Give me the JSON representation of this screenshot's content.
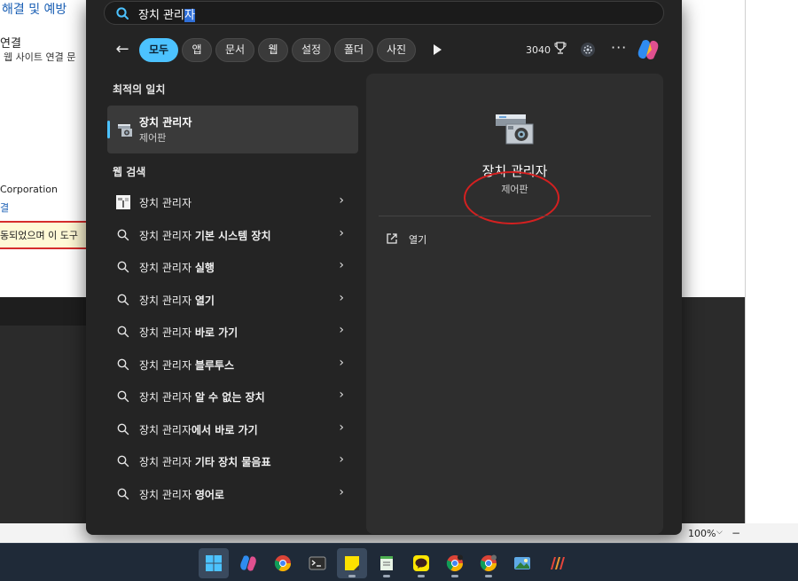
{
  "background_app": {
    "heading": "해결 및 예방",
    "sub1": "연결",
    "sub2": "웹 사이트 연결 문",
    "corp": "Corporation",
    "corp_link": "결",
    "alert": "동되었으며 이 도구",
    "zoom": "100%"
  },
  "search": {
    "query_plain": "장치 관리",
    "query_selected": "자"
  },
  "filters": [
    "모두",
    "앱",
    "문서",
    "웹",
    "설정",
    "폴더",
    "사진"
  ],
  "rewards": {
    "points": "3040"
  },
  "best_match": {
    "section_label": "최적의 일치",
    "title": "장치 관리자",
    "subtitle": "제어판"
  },
  "web_search": {
    "section_label": "웹 검색",
    "results": [
      {
        "base": "장치 관리자",
        "bold": ""
      },
      {
        "base": "장치 관리자 ",
        "bold": "기본 시스템 장치"
      },
      {
        "base": "장치 관리자 ",
        "bold": "실행"
      },
      {
        "base": "장치 관리자 ",
        "bold": "열기"
      },
      {
        "base": "장치 관리자 ",
        "bold": "바로 가기"
      },
      {
        "base": "장치 관리자 ",
        "bold": "블루투스"
      },
      {
        "base": "장치 관리자 ",
        "bold": "알 수 없는 장치"
      },
      {
        "base": "장치 관리자",
        "bold": "에서 바로 가기"
      },
      {
        "base": "장치 관리자 ",
        "bold": "기타 장치 물음표"
      },
      {
        "base": "장치 관리자 ",
        "bold": "영어로"
      }
    ]
  },
  "preview": {
    "title": "장치 관리자",
    "subtitle": "제어판",
    "open_label": "열기"
  },
  "colors": {
    "accent": "#4cc2ff",
    "annotation": "#d42020"
  },
  "taskbar": {
    "items": [
      "start-icon",
      "copilot-icon",
      "chrome-icon",
      "terminal-icon",
      "sticky-notes-icon",
      "notepad-icon",
      "kakaotalk-icon",
      "chrome-profile-icon",
      "chrome-profile-icon",
      "photos-icon",
      "app-icon"
    ]
  }
}
